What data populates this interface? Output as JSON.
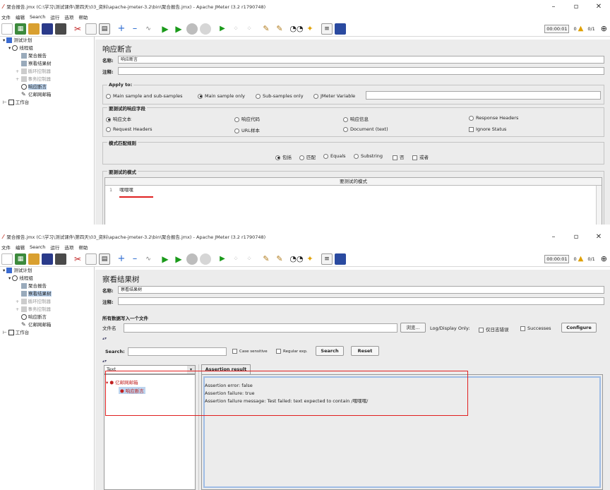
{
  "window_top": {
    "title": "聚合报告.jmx (C:\\学习\\测试课件\\第四天\\03_资料\\apache-jmeter-3.2\\bin\\聚合报告.jmx) - Apache JMeter (3.2 r1790748)",
    "menu": [
      "文件",
      "编辑",
      "Search",
      "运行",
      "选项",
      "帮助"
    ],
    "timer": "00:00:01",
    "warn_count": "0",
    "threads": "0/1",
    "tree": {
      "test_plan": "测试计划",
      "thread_group": "线程组",
      "agg_report": "聚合报告",
      "view_results": "察看结果树",
      "loop": "循环控制器",
      "if_ctrl": "事务控制器",
      "assertion": "响应断言",
      "http": "亿邮网邮箱",
      "workbench": "工作台"
    },
    "panel": {
      "title": "响应断言",
      "name_label": "名称:",
      "name_value": "响应断言",
      "comment_label": "注释:",
      "apply_to": {
        "label": "Apply to:",
        "options": [
          "Main sample and sub-samples",
          "Main sample only",
          "Sub-samples only",
          "JMeter Variable"
        ],
        "selected": 1
      },
      "fields": {
        "label": "要测试的响应字段",
        "opt1": "响应文本",
        "opt2": "响应代码",
        "opt3": "响应信息",
        "opt4": "Response Headers",
        "opt5": "Request Headers",
        "opt6": "URL样本",
        "opt7": "Document (text)",
        "opt8": "Ignore Status"
      },
      "rules": {
        "label": "模式匹配规则",
        "o1": "包括",
        "o2": "匹配",
        "o3": "Equals",
        "o4": "Substring",
        "o5": "否",
        "o6": "或者"
      },
      "patterns": {
        "label": "要测试的模式",
        "header": "要测试的模式",
        "row_index": "1",
        "row_value": "嘿嘿嘿"
      }
    }
  },
  "window_bottom": {
    "title": "聚合报告.jmx (C:\\学习\\测试课件\\第四天\\03_资料\\apache-jmeter-3.2\\bin\\聚合报告.jmx) - Apache JMeter (3.2 r1790748)",
    "menu": [
      "文件",
      "编辑",
      "Search",
      "运行",
      "选项",
      "帮助"
    ],
    "timer": "00:00:01",
    "warn_count": "0",
    "threads": "0/1",
    "tree": {
      "test_plan": "测试计划",
      "thread_group": "线程组",
      "agg_report": "聚合报告",
      "view_results": "察看结果树",
      "loop": "循环控制器",
      "if_ctrl": "事务控制器",
      "assertion": "响应断言",
      "http": "亿邮网邮箱",
      "workbench": "工作台"
    },
    "panel": {
      "title": "察看结果树",
      "name_label": "名称:",
      "name_value": "察看结果树",
      "comment_label": "注释:",
      "write_label": "所有数据写入一个文件",
      "file_label": "文件名",
      "browse": "浏览...",
      "log_display": "Log/Display Only:",
      "errors_only": "仅日志错误",
      "successes": "Successes",
      "configure": "Configure",
      "search_label": "Search:",
      "case_sensitive": "Case sensitive",
      "regex": "Regular exp.",
      "search_btn": "Search",
      "reset_btn": "Reset",
      "renderer": "Text",
      "result_tab": "Assertion result",
      "res_parent": "亿邮网邮箱",
      "res_child": "响应断言",
      "assert_lines": [
        "Assertion error: false",
        "Assertion failure: true",
        "Assertion failure message: Test failed: text expected to contain /嘿嘿嘿/"
      ]
    }
  },
  "colors": {
    "panel_bg": "#ececec",
    "selection": "#bcd4ef",
    "highlight_red": "#e02020"
  }
}
